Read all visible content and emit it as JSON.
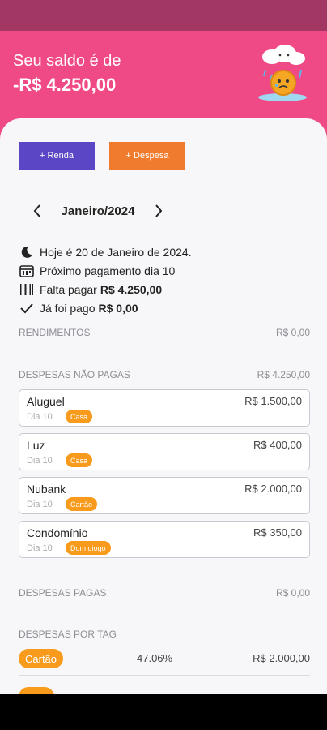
{
  "header": {
    "label": "Seu saldo é de",
    "balance": "-R$ 4.250,00"
  },
  "actions": {
    "income_label": "+ Renda",
    "expense_label": "+ Despesa"
  },
  "month": {
    "label": "Janeiro/2024"
  },
  "summary": {
    "today": "Hoje é 20 de Janeiro de 2024.",
    "next_payment": "Próximo pagamento dia 10",
    "to_pay_label": "Falta pagar",
    "to_pay_value": "R$ 4.250,00",
    "paid_label": "Já foi pago",
    "paid_value": "R$ 0,00"
  },
  "sections": {
    "income": {
      "label": "RENDIMENTOS",
      "value": "R$ 0,00"
    },
    "unpaid": {
      "label": "DESPESAS NÃO PAGAS",
      "value": "R$ 4.250,00"
    },
    "paid": {
      "label": "DESPESAS PAGAS",
      "value": "R$ 0,00"
    },
    "by_tag": {
      "label": "DESPESAS POR TAG"
    }
  },
  "expenses": [
    {
      "name": "Aluguel",
      "amount": "R$ 1.500,00",
      "day": "Dia 10",
      "tag": "Casa"
    },
    {
      "name": "Luz",
      "amount": "R$ 400,00",
      "day": "Dia 10",
      "tag": "Casa"
    },
    {
      "name": "Nubank",
      "amount": "R$ 2.000,00",
      "day": "Dia 10",
      "tag": "Cartão"
    },
    {
      "name": "Condomínio",
      "amount": "R$ 350,00",
      "day": "Dia 10",
      "tag": "Dom diogo"
    }
  ],
  "tags": [
    {
      "name": "Cartão",
      "percent": "47.06%",
      "amount": "R$ 2.000,00"
    }
  ],
  "colors": {
    "header": "#f04a86",
    "income_button": "#5b47c6",
    "expense_button": "#f07b2c",
    "tag": "#f89b1c"
  }
}
